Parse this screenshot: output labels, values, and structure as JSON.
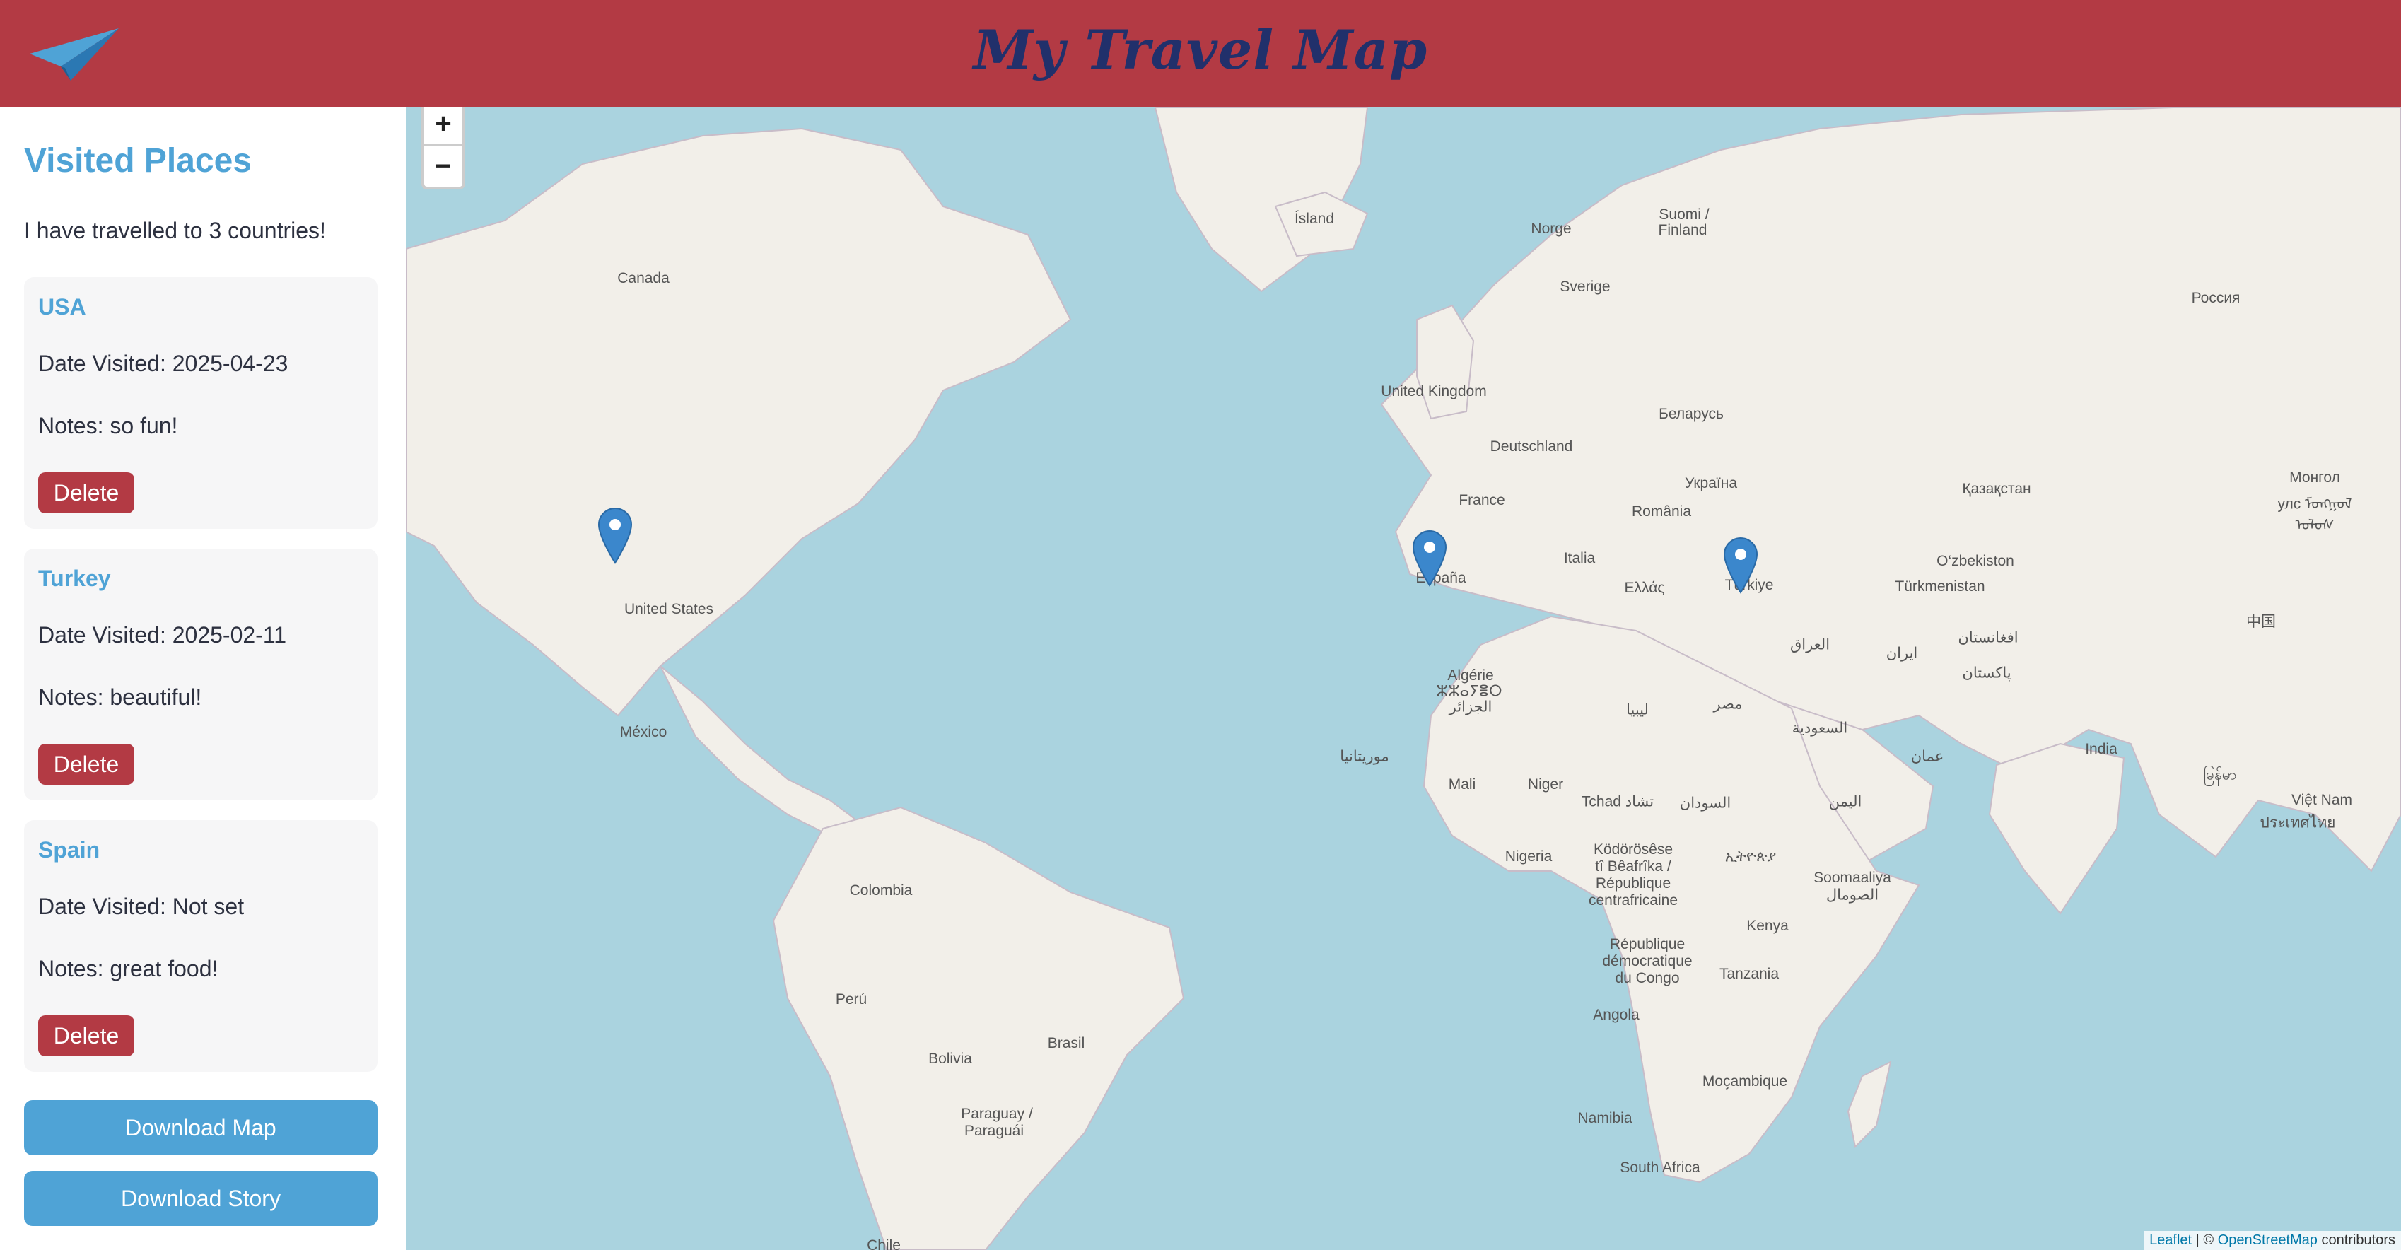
{
  "header": {
    "title": "My Travel Map",
    "logo_icon": "paper-plane-icon"
  },
  "sidebar": {
    "title": "Visited Places",
    "summary": "I have travelled to 3 countries!",
    "places": [
      {
        "name": "USA",
        "date": "Date Visited: 2025-04-23",
        "notes": "Notes: so fun!",
        "delete_label": "Delete"
      },
      {
        "name": "Turkey",
        "date": "Date Visited: 2025-02-11",
        "notes": "Notes: beautiful!",
        "delete_label": "Delete"
      },
      {
        "name": "Spain",
        "date": "Date Visited: Not set",
        "notes": "Notes: great food!",
        "delete_label": "Delete"
      }
    ],
    "download_map_label": "Download Map",
    "download_story_label": "Download Story"
  },
  "map": {
    "zoom_in": "+",
    "zoom_out": "−",
    "attribution": {
      "leaflet": "Leaflet",
      "sep": " | © ",
      "osm": "OpenStreetMap",
      "suffix": " contributors"
    },
    "labels": {
      "island": "Ísland",
      "norge": "Norge",
      "suomi": "Suomi /",
      "finland": "Finland",
      "sverige": "Sverige",
      "rossiya": "Россия",
      "canada": "Canada",
      "uk": "United Kingdom",
      "belarus": "Беларусь",
      "deutschland": "Deutschland",
      "ukraina": "Україна",
      "france": "France",
      "romania": "România",
      "kazakhstan": "Қазақстан",
      "mongol1": "Монгол",
      "mongol2": "улс ᠮᠣᠩᠭᠣᠯ",
      "mongol3": "ᠤᠯᠤᠰ",
      "italia": "Italia",
      "espana": "España",
      "ozbekiston": "O‘zbekiston",
      "ellas": "Ελλάς",
      "turkiye": "Türkiye",
      "turkmenistan": "Türkmenistan",
      "iraq": "العراق",
      "iran": "ایران",
      "afghanistan": "افغانستان",
      "pakistan": "پاکستان",
      "china": "中国",
      "us": "United States",
      "algerie": "Algérie",
      "algerie2": "ⵣⵣⴰⵢⴻⵔ",
      "algerie3": "الجزائر",
      "libya": "ليبيا",
      "misr": "مصر",
      "saudi": "السعودية",
      "mexico": "México",
      "mauritania": "موريتانيا",
      "oman": "عمان",
      "india": "India",
      "mali": "Mali",
      "niger": "Niger",
      "tchad": "Tchad تشاد",
      "sudan": "السودان",
      "yemen": "اليمن",
      "myanmar": "မြန်မာ",
      "vietnam": "Việt Nam",
      "thailand": "ประเทศไทย",
      "nigeria": "Nigeria",
      "car1": "Ködörösêse",
      "car2": "tî Bêafrîka /",
      "car3": "République",
      "car4": "centrafricaine",
      "ethiopia": "ኢትዮጵያ",
      "somalia1": "Soomaaliya",
      "somalia2": "الصومال",
      "colombia": "Colombia",
      "kenya": "Kenya",
      "rdc1": "République",
      "rdc2": "démocratique",
      "rdc3": "du Congo",
      "tanzania": "Tanzania",
      "peru": "Perú",
      "angola": "Angola",
      "brasil": "Brasil",
      "bolivia": "Bolivia",
      "mocambique": "Moçambique",
      "paraguay1": "Paraguay /",
      "paraguay2": "Paraguái",
      "namibia": "Namibia",
      "southafrica": "South Africa",
      "chile": "Chile"
    }
  },
  "colors": {
    "header": "#b33a44",
    "title_text": "#21306b",
    "accent": "#4fa3d6",
    "delete": "#b33a44",
    "ocean": "#aad3df",
    "land": "#f2efe9"
  }
}
